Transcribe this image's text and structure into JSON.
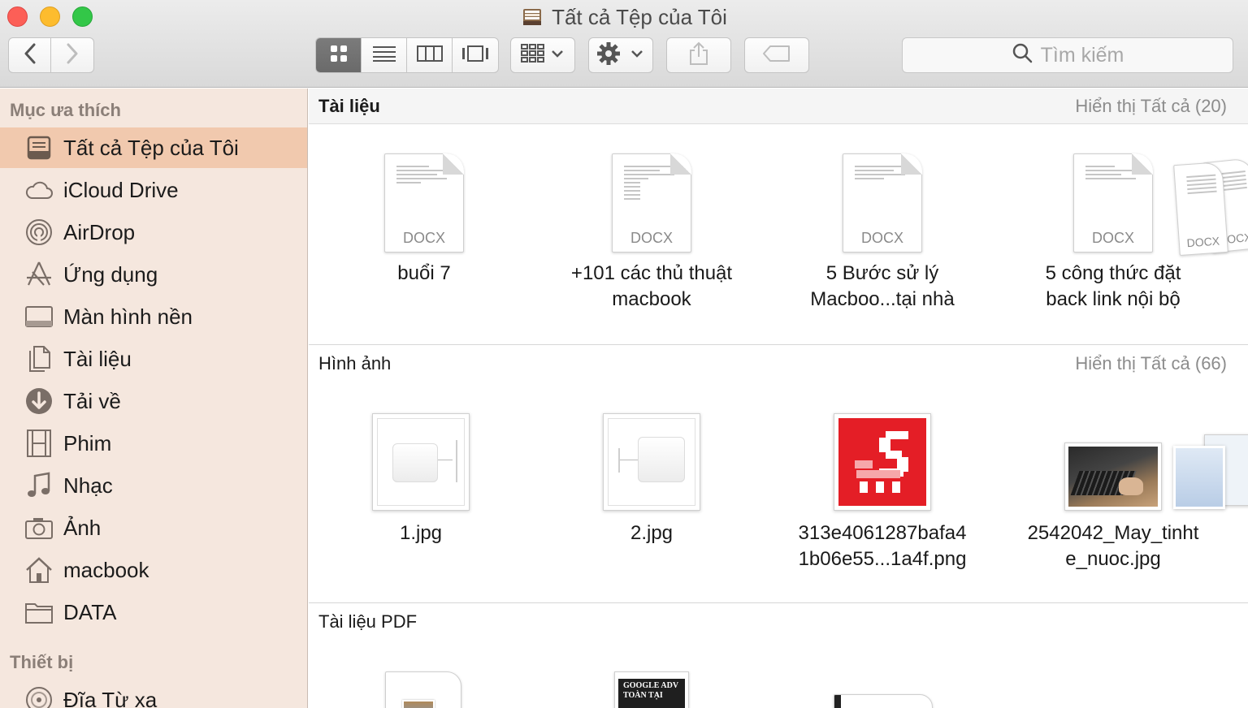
{
  "window": {
    "title": "Tất cả Tệp của Tôi",
    "title_icon": "all-my-files-icon"
  },
  "toolbar": {
    "back_icon": "chevron-left-icon",
    "forward_icon": "chevron-right-icon",
    "view_modes": [
      "icon-view",
      "list-view",
      "column-view",
      "cover-flow-view"
    ],
    "active_view": "icon-view",
    "arrange_icon": "arrange-grid-icon",
    "action_icon": "gear-icon",
    "share_icon": "share-icon",
    "tags_icon": "tag-icon",
    "search_placeholder": "Tìm kiếm"
  },
  "sidebar": {
    "favorites_header": "Mục ưa thích",
    "items": [
      {
        "label": "Tất cả Tệp của Tôi",
        "icon": "all-my-files-icon",
        "selected": true
      },
      {
        "label": "iCloud Drive",
        "icon": "cloud-icon"
      },
      {
        "label": "AirDrop",
        "icon": "airdrop-icon"
      },
      {
        "label": "Ứng dụng",
        "icon": "applications-icon"
      },
      {
        "label": "Màn hình nền",
        "icon": "desktop-icon"
      },
      {
        "label": "Tài liệu",
        "icon": "documents-icon"
      },
      {
        "label": "Tải về",
        "icon": "downloads-icon"
      },
      {
        "label": "Phim",
        "icon": "movies-icon"
      },
      {
        "label": "Nhạc",
        "icon": "music-icon"
      },
      {
        "label": "Ảnh",
        "icon": "camera-icon"
      },
      {
        "label": "macbook",
        "icon": "home-icon"
      },
      {
        "label": "DATA",
        "icon": "folder-icon"
      }
    ],
    "devices_header": "Thiết bị",
    "devices": [
      {
        "label": "Đĩa Từ xa",
        "icon": "remote-disc-icon"
      }
    ]
  },
  "groups": {
    "documents": {
      "title": "Tài liệu",
      "show_all": "Hiển thị Tất cả (20)",
      "items": [
        {
          "label": "buổi 7",
          "ext": "DOCX"
        },
        {
          "label": "+101 các thủ thuật\nmacbook",
          "ext": "DOCX"
        },
        {
          "label": "5 Bước sử lý\nMacboo...tại nhà",
          "ext": "DOCX"
        },
        {
          "label": "5 công thức đặt\nback link nội bộ",
          "ext": "DOCX"
        }
      ],
      "stack_ext": [
        "DOCX",
        "DOCX"
      ]
    },
    "images": {
      "title": "Hình ảnh",
      "show_all": "Hiển thị Tất cả (66)",
      "items": [
        {
          "label": "1.jpg"
        },
        {
          "label": "2.jpg"
        },
        {
          "label": "313e4061287bafa4\n1b06e55...1a4f.png"
        },
        {
          "label": "2542042_May_tinht\ne_nuoc.jpg"
        }
      ]
    },
    "pdf": {
      "title": "Tài liệu PDF",
      "thumb_text": "GOOGLE ADV\nTOÀN TẠI"
    }
  },
  "colors": {
    "sidebar_bg": "#f5e7de",
    "selection": "#f1c9ae",
    "red_logo": "#e41e26"
  }
}
